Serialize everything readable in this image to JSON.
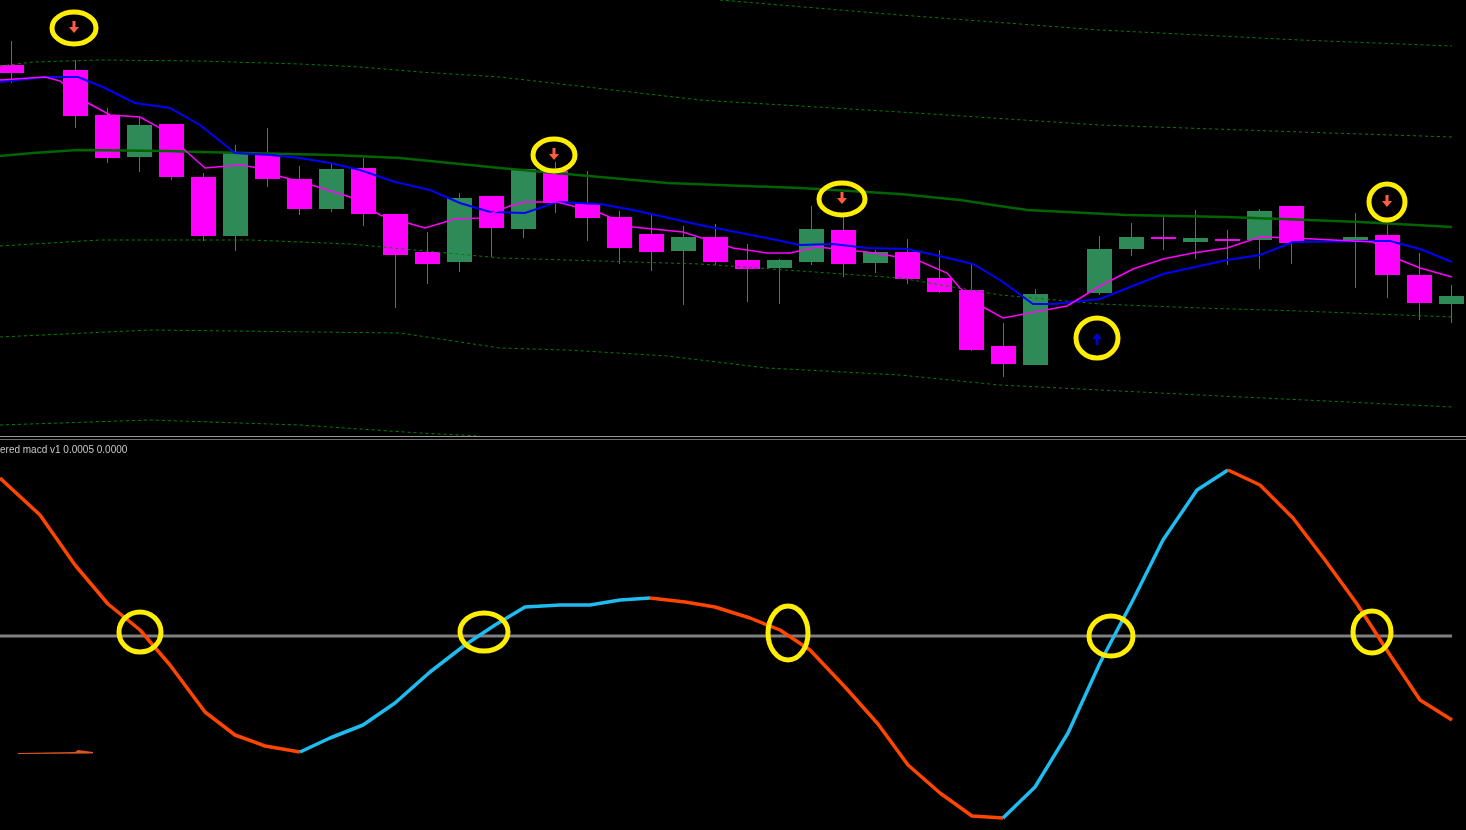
{
  "price_pane": {
    "candles": [
      {
        "kind": "bear"
      },
      {
        "kind": "bear"
      },
      {
        "kind": "bear"
      },
      {
        "kind": "bull"
      },
      {
        "kind": "bear"
      },
      {
        "kind": "bear"
      },
      {
        "kind": "bull"
      },
      {
        "kind": "bear"
      },
      {
        "kind": "bear"
      },
      {
        "kind": "bull"
      },
      {
        "kind": "bear"
      },
      {
        "kind": "bear"
      },
      {
        "kind": "bear"
      },
      {
        "kind": "bull"
      },
      {
        "kind": "bear"
      },
      {
        "kind": "bull"
      },
      {
        "kind": "bear"
      },
      {
        "kind": "bear"
      },
      {
        "kind": "bear"
      },
      {
        "kind": "bear"
      },
      {
        "kind": "bull"
      },
      {
        "kind": "bear"
      },
      {
        "kind": "bear"
      },
      {
        "kind": "bull"
      },
      {
        "kind": "bull"
      },
      {
        "kind": "bear"
      },
      {
        "kind": "bull"
      },
      {
        "kind": "bear"
      },
      {
        "kind": "bear"
      },
      {
        "kind": "bear"
      },
      {
        "kind": "bear"
      },
      {
        "kind": "bull"
      },
      {
        "kind": "bull"
      },
      {
        "kind": "bull"
      },
      {
        "kind": "bear"
      },
      {
        "kind": "bull"
      },
      {
        "kind": "bear"
      },
      {
        "kind": "bull"
      },
      {
        "kind": "bear"
      },
      {
        "kind": "bull"
      },
      {
        "kind": "bear"
      },
      {
        "kind": "bear"
      },
      {
        "kind": "bull"
      }
    ],
    "signals": [
      {
        "kind": "down"
      },
      {
        "kind": "down"
      },
      {
        "kind": "down"
      },
      {
        "kind": "up"
      },
      {
        "kind": "down"
      }
    ]
  },
  "macd_pane": {
    "label": "ered macd v1 0.0005 0.0000",
    "segments": [
      {
        "kind": "falling"
      },
      {
        "kind": "rising"
      },
      {
        "kind": "falling"
      },
      {
        "kind": "rising"
      },
      {
        "kind": "falling"
      }
    ]
  }
}
